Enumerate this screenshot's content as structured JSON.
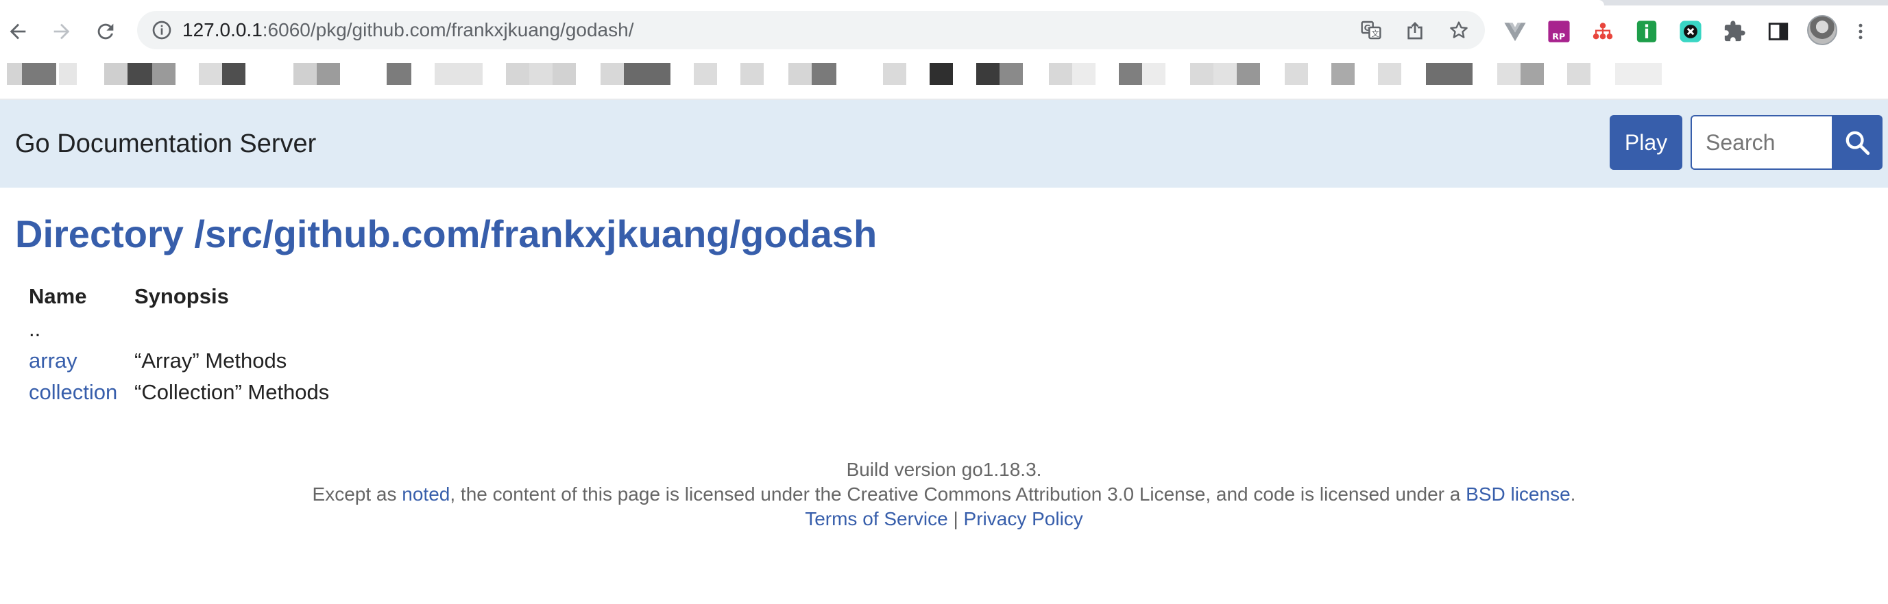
{
  "browser": {
    "url_host": "127.0.0.1",
    "url_rest": ":6060/pkg/github.com/frankxjkuang/godash/",
    "icons": {
      "back": "back-arrow-icon",
      "forward": "forward-arrow-icon",
      "reload": "reload-icon",
      "site_info": "info-icon",
      "translate": "translate-icon",
      "share": "share-icon",
      "bookmark": "star-icon",
      "extensions": "puzzle-icon",
      "side_panel": "side-panel-icon",
      "menu": "three-dots-icon"
    }
  },
  "header": {
    "site_title": "Go Documentation Server",
    "play_label": "Play",
    "search_placeholder": "Search",
    "search_icon": "magnifier-icon"
  },
  "main": {
    "heading": "Directory /src/github.com/frankxjkuang/godash",
    "columns": [
      "Name",
      "Synopsis"
    ],
    "parent_link": "..",
    "rows": [
      {
        "name": "array",
        "synopsis": "“Array” Methods"
      },
      {
        "name": "collection",
        "synopsis": "“Collection” Methods"
      }
    ]
  },
  "footer": {
    "build": "Build version go1.18.3.",
    "license_prefix": "Except as ",
    "noted_link": "noted",
    "license_middle": ", the content of this page is licensed under the Creative Commons Attribution 3.0 License, and code is licensed under a ",
    "bsd_link": "BSD license",
    "license_suffix": ".",
    "terms_link": "Terms of Service",
    "separator": "|",
    "privacy_link": "Privacy Policy"
  },
  "colors": {
    "accent": "#375eab",
    "topbar_bg": "#e0ebf5",
    "text": "#222222",
    "footer_text": "#666666"
  }
}
